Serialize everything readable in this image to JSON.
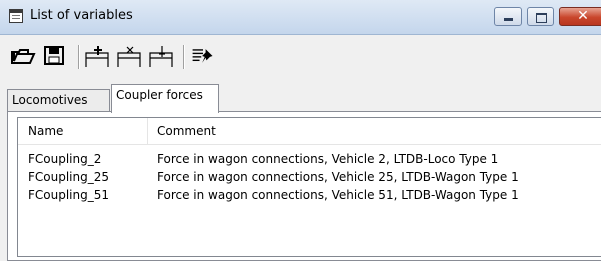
{
  "window": {
    "title": "List of variables",
    "close_glyph": "✕"
  },
  "toolbar": {
    "icons": [
      "folder-open-icon",
      "save-icon",
      "add-variable-icon",
      "delete-variable-icon",
      "insert-variable-icon",
      "pin-list-icon"
    ]
  },
  "tabs": [
    {
      "label": "Locomotives",
      "selected": false
    },
    {
      "label": "Coupler forces",
      "selected": true
    }
  ],
  "list": {
    "columns": [
      "Name",
      "Comment"
    ],
    "rows": [
      {
        "name": "FCoupling_2",
        "comment": "Force in wagon connections, Vehicle 2, LTDB-Loco Type 1"
      },
      {
        "name": "FCoupling_25",
        "comment": "Force in wagon connections, Vehicle 25, LTDB-Wagon Type 1"
      },
      {
        "name": "FCoupling_51",
        "comment": "Force in wagon connections, Vehicle 51, LTDB-Wagon Type 1"
      }
    ]
  }
}
